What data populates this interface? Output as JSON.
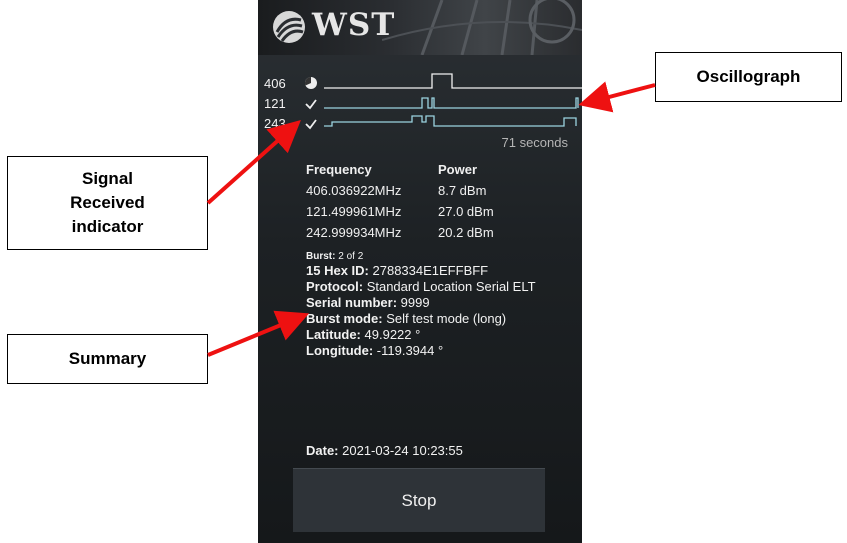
{
  "app": {
    "logo_text": "WST"
  },
  "channels": [
    {
      "label": "406",
      "icon": "partial-circle-icon"
    },
    {
      "label": "121",
      "icon": "checkmark-icon"
    },
    {
      "label": "243",
      "icon": "checkmark-icon"
    }
  ],
  "oscillograph": {
    "elapsed": "71 seconds"
  },
  "signal_table": {
    "headers": [
      "Frequency",
      "Power"
    ],
    "rows": [
      [
        "406.036922MHz",
        "8.7 dBm"
      ],
      [
        "121.499961MHz",
        "27.0 dBm"
      ],
      [
        "242.999934MHz",
        "20.2 dBm"
      ]
    ]
  },
  "summary": {
    "burst_label": "Burst:",
    "burst_value": "2 of 2",
    "hex_label": "15 Hex ID:",
    "hex_value": "2788334E1EFFBFF",
    "protocol_label": "Protocol:",
    "protocol_value": "Standard Location Serial ELT",
    "serial_label": "Serial number:",
    "serial_value": "9999",
    "mode_label": "Burst mode:",
    "mode_value": "Self test mode (long)",
    "lat_label": "Latitude:",
    "lat_value": "49.9222 °",
    "lon_label": "Longitude:",
    "lon_value": "-119.3944 °"
  },
  "date": {
    "label": "Date:",
    "value": "2021-03-24 10:23:55"
  },
  "buttons": {
    "stop": "Stop"
  },
  "callouts": {
    "oscillograph": "Oscillograph",
    "signal_line1": "Signal",
    "signal_line2": "Received",
    "signal_line3": "indicator",
    "summary": "Summary"
  },
  "colors": {
    "accent": "#9bd3e0",
    "arrow": "#ee1111",
    "background": "#1d2124"
  }
}
